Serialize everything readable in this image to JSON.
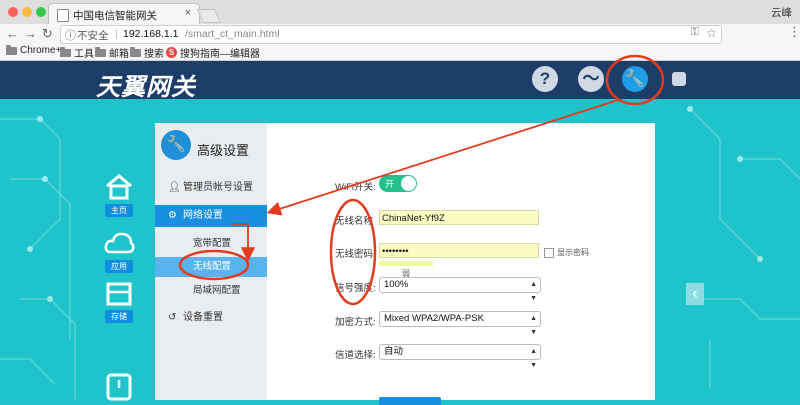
{
  "browser": {
    "tab_title": "中国电信智能网关",
    "tab_close": "×",
    "user_name": "云峰",
    "address": {
      "security_label": "不安全",
      "host": "192.168.1.1",
      "path": "/smart_ct_main.html"
    },
    "bookmarks": [
      {
        "label": "Chrome+",
        "icon": "folder-icon"
      },
      {
        "label": "工具",
        "icon": "folder-icon"
      },
      {
        "label": "邮箱",
        "icon": "folder-icon"
      },
      {
        "label": "搜索",
        "icon": "folder-icon"
      },
      {
        "label": "搜狗指南—编辑器",
        "icon": "sogou-icon"
      }
    ]
  },
  "app": {
    "logo": "天翼网关",
    "header_icons": [
      "help-icon",
      "status-icon",
      "settings-wrench-icon",
      "exit-icon"
    ],
    "left_nav": [
      {
        "label": "主页",
        "icon": "home-icon"
      },
      {
        "label": "应用",
        "icon": "cloud-icon"
      },
      {
        "label": "存储",
        "icon": "storage-icon"
      },
      {
        "label": "",
        "icon": "power-icon"
      }
    ]
  },
  "sidebar": {
    "title": "高级设置",
    "items": [
      {
        "label": "管理员帐号设置",
        "icon": "user-icon"
      },
      {
        "label": "网络设置",
        "icon": "gear-icon"
      },
      {
        "label": "设备重置",
        "icon": "reset-icon"
      }
    ],
    "sub_items": [
      {
        "label": "宽带配置"
      },
      {
        "label": "无线配置"
      },
      {
        "label": "局域网配置"
      }
    ]
  },
  "form": {
    "wifi_switch_label": "WiFi开关:",
    "wifi_switch_value": "开",
    "ssid_label": "无线名称",
    "ssid_value": "ChinaNet-Yf9Z",
    "password_label": "无线密码:",
    "password_value": "••••••••",
    "show_password_label": "显示密码",
    "strength_text": "弱",
    "signal_label": "信号强度:",
    "signal_value": "100%",
    "encryption_label": "加密方式:",
    "encryption_value": "Mixed WPA2/WPA-PSK",
    "channel_label": "信道选择:",
    "channel_value": "自动"
  },
  "colors": {
    "header_bg": "#1c3d68",
    "accent_blue": "#1a8fe2",
    "teal_bg": "#1fc4ca",
    "annotation_red": "#e23b1e",
    "toggle_on": "#25c08a"
  }
}
